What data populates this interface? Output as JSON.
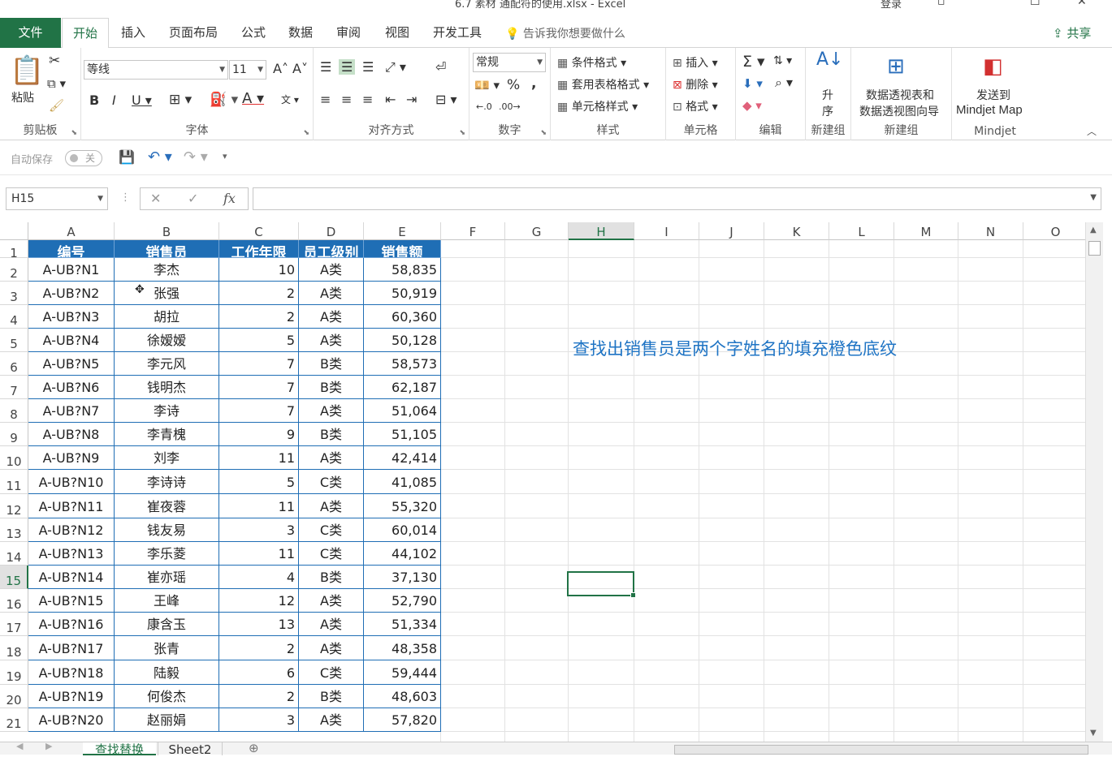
{
  "window": {
    "title": "6.7 素材 通配符的使用.xlsx  -  Excel",
    "login": "登录",
    "restore_glyph": "▫",
    "maximize_glyph": "☐",
    "close_glyph": "✕"
  },
  "tabs": [
    "文件",
    "开始",
    "插入",
    "页面布局",
    "公式",
    "数据",
    "审阅",
    "视图",
    "开发工具"
  ],
  "tell_me": "告诉我你想要做什么",
  "share": "共享",
  "ribbon": {
    "clipboard": {
      "label": "剪贴板",
      "paste": "粘贴"
    },
    "font": {
      "label": "字体",
      "name": "等线",
      "size": "11"
    },
    "alignment": {
      "label": "对齐方式"
    },
    "number": {
      "label": "数字",
      "format": "常规",
      "percent": "%",
      "comma": ","
    },
    "styles": {
      "label": "样式",
      "conditional": "条件格式",
      "table": "套用表格格式",
      "cell": "单元格样式"
    },
    "cells": {
      "label": "单元格",
      "insert": "插入",
      "delete": "删除",
      "format": "格式"
    },
    "editing": {
      "label": "编辑"
    },
    "newgroup1": {
      "label": "新建组",
      "sort_asc_l1": "升",
      "sort_asc_l2": "序"
    },
    "newgroup2": {
      "label": "新建组",
      "pivot_l1": "数据透视表和",
      "pivot_l2": "数据透视图向导"
    },
    "mindjet": {
      "label": "Mindjet",
      "send_l1": "发送到",
      "send_l2": "Mindjet Map"
    }
  },
  "qat": {
    "autosave": "自动保存",
    "autosave_state": "关"
  },
  "formula_bar": {
    "name_box": "H15",
    "fx": "fx",
    "formula": ""
  },
  "columns": [
    "A",
    "B",
    "C",
    "D",
    "E",
    "F",
    "G",
    "H",
    "I",
    "J",
    "K",
    "L",
    "M",
    "N",
    "O"
  ],
  "selected_column": "H",
  "selected_row": 15,
  "rows": [
    1,
    2,
    3,
    4,
    5,
    6,
    7,
    8,
    9,
    10,
    11,
    12,
    13,
    14,
    15,
    16,
    17,
    18,
    19,
    20,
    21
  ],
  "table": {
    "headers": [
      "编号",
      "销售员",
      "工作年限",
      "员工级别",
      "销售额"
    ],
    "data": [
      [
        "A-UB?N1",
        "李杰",
        "10",
        "A类",
        "58,835"
      ],
      [
        "A-UB?N2",
        "张强",
        "2",
        "A类",
        "50,919"
      ],
      [
        "A-UB?N3",
        "胡拉",
        "2",
        "A类",
        "60,360"
      ],
      [
        "A-UB?N4",
        "徐嫒嫒",
        "5",
        "A类",
        "50,128"
      ],
      [
        "A-UB?N5",
        "李元风",
        "7",
        "B类",
        "58,573"
      ],
      [
        "A-UB?N6",
        "钱明杰",
        "7",
        "B类",
        "62,187"
      ],
      [
        "A-UB?N7",
        "李诗",
        "7",
        "A类",
        "51,064"
      ],
      [
        "A-UB?N8",
        "李青槐",
        "9",
        "B类",
        "51,105"
      ],
      [
        "A-UB?N9",
        "刘李",
        "11",
        "A类",
        "42,414"
      ],
      [
        "A-UB?N10",
        "李诗诗",
        "5",
        "C类",
        "41,085"
      ],
      [
        "A-UB?N11",
        "崔夜蓉",
        "11",
        "A类",
        "55,320"
      ],
      [
        "A-UB?N12",
        "钱友易",
        "3",
        "C类",
        "60,014"
      ],
      [
        "A-UB?N13",
        "李乐菱",
        "11",
        "C类",
        "44,102"
      ],
      [
        "A-UB?N14",
        "崔亦瑶",
        "4",
        "B类",
        "37,130"
      ],
      [
        "A-UB?N15",
        "王峰",
        "12",
        "A类",
        "52,790"
      ],
      [
        "A-UB?N16",
        "康含玉",
        "13",
        "A类",
        "51,334"
      ],
      [
        "A-UB?N17",
        "张青",
        "2",
        "A类",
        "48,358"
      ],
      [
        "A-UB?N18",
        "陆毅",
        "6",
        "C类",
        "59,444"
      ],
      [
        "A-UB?N19",
        "何俊杰",
        "2",
        "B类",
        "48,603"
      ],
      [
        "A-UB?N20",
        "赵丽娟",
        "3",
        "A类",
        "57,820"
      ]
    ]
  },
  "note": "查找出销售员是两个字姓名的填充橙色底纹",
  "sheets": [
    "查找替换",
    "Sheet2"
  ],
  "colors": {
    "accent": "#217346",
    "table_header": "#1f6eb5",
    "note": "#1f74c4"
  }
}
